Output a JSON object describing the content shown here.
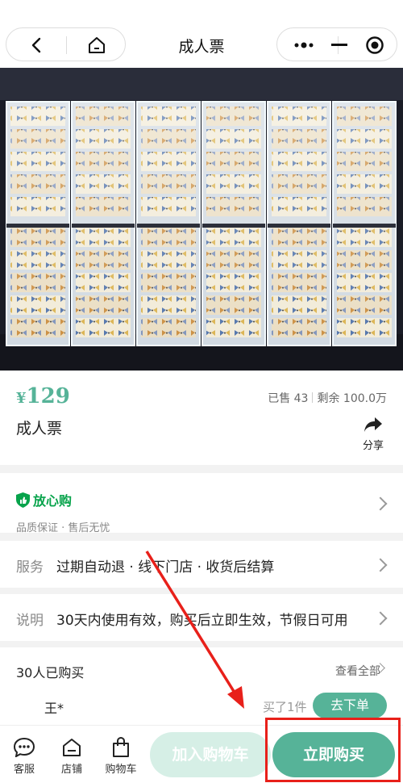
{
  "nav": {
    "title": "成人票"
  },
  "product": {
    "currency": "¥",
    "price": "129",
    "sold": "已售 43",
    "remaining": "剩余 100.0万",
    "name": "成人票",
    "share_label": "分享"
  },
  "guarantee": {
    "title": "放心购",
    "tags": "品质保证 · 售后无忧"
  },
  "service": {
    "label": "服务",
    "text": "过期自动退 · 线下门店 · 收货后结算"
  },
  "note": {
    "label": "说明",
    "text": "30天内使用有效，购买后立即生效，节假日可用"
  },
  "buyers": {
    "title": "30人已购买",
    "view_all": "查看全部",
    "name": "王*",
    "qty": "买了1件",
    "action": "去下单"
  },
  "bottom_bar": {
    "service": "客服",
    "store": "店铺",
    "cart": "购物车",
    "add_to_cart": "加入购物车",
    "buy_now": "立即购买"
  },
  "colors": {
    "accent": "#56b398",
    "guard_green": "#07a34b",
    "highlight_red": "#e8201a"
  }
}
